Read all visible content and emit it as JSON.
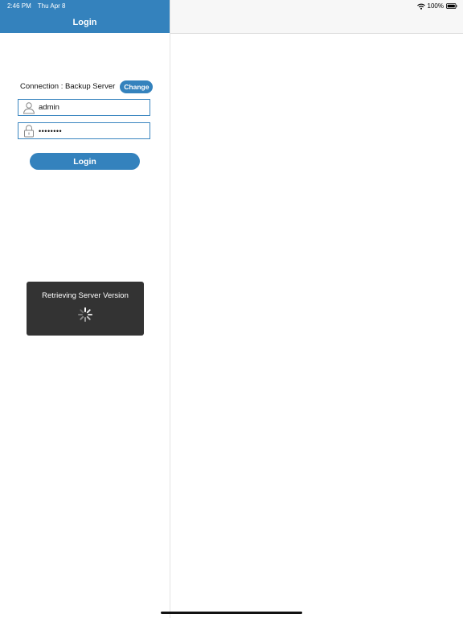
{
  "status_bar": {
    "time": "2:46 PM",
    "date": "Thu Apr 8",
    "battery": "100%",
    "wifi_icon": "wifi-icon",
    "battery_icon": "battery-icon"
  },
  "nav": {
    "title": "Login"
  },
  "connection": {
    "label": "Connection : Backup Server",
    "change_button": "Change"
  },
  "username": {
    "value": "admin",
    "icon": "user-icon"
  },
  "password": {
    "value": "••••••••",
    "icon": "lock-icon"
  },
  "login_button": "Login",
  "toast": {
    "message": "Retrieving Server Version",
    "icon": "spinner-icon"
  },
  "colors": {
    "accent": "#3482bd",
    "toast_bg": "#333333"
  }
}
